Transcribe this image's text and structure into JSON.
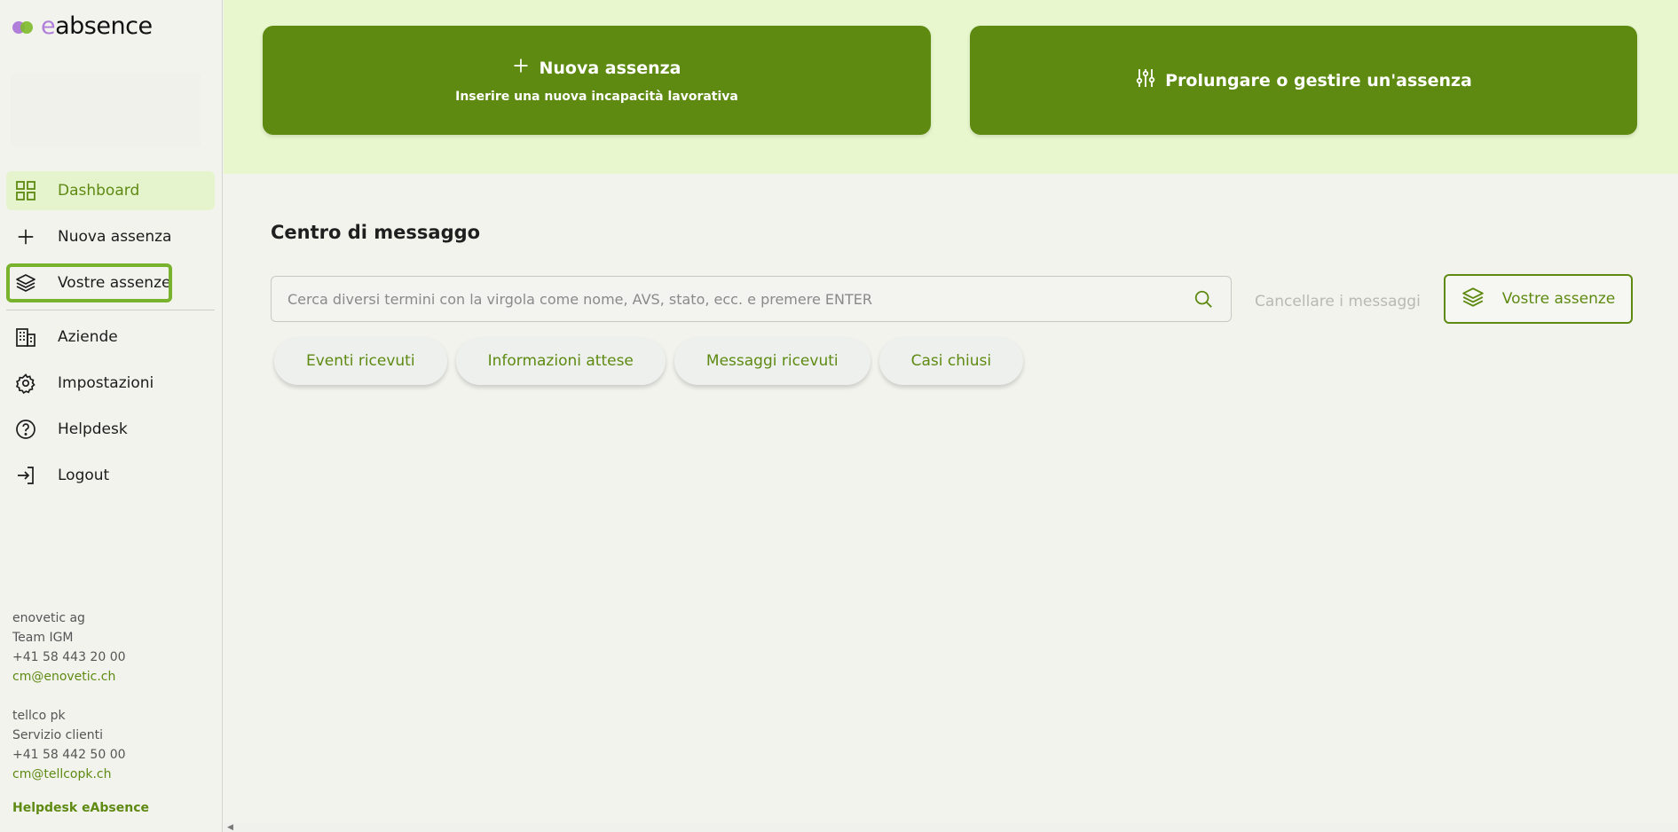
{
  "brand": {
    "logo_e": "e",
    "logo_rest": "absence",
    "accent": "#5e8a12",
    "logo_dot_colors": [
      "#b07fd9",
      "#7dbb2a"
    ]
  },
  "sidebar": {
    "items": [
      {
        "label": "Dashboard",
        "icon": "dashboard-grid-icon"
      },
      {
        "label": "Nuova assenza",
        "icon": "plus-icon"
      },
      {
        "label": "Vostre assenze",
        "icon": "layers-icon"
      },
      {
        "label": "Aziende",
        "icon": "building-icon"
      },
      {
        "label": "Impostazioni",
        "icon": "gear-icon"
      },
      {
        "label": "Helpdesk",
        "icon": "help-circle-icon"
      },
      {
        "label": "Logout",
        "icon": "logout-icon"
      }
    ],
    "contacts": {
      "company1": {
        "name": "enovetic ag",
        "team": "Team IGM",
        "phone": "+41 58 443 20 00",
        "email": "cm@enovetic.ch"
      },
      "company2": {
        "name": "tellco pk",
        "team": "Servizio clienti",
        "phone": "+41 58 442 50 00",
        "email": "cm@tellcopk.ch"
      },
      "helpdesk_link": "Helpdesk eAbsence"
    }
  },
  "banner": {
    "new_absence": {
      "title": "Nuova assenza",
      "subtitle": "Inserire una nuova incapacità lavorativa"
    },
    "manage_absence": {
      "title": "Prolungare o gestire un'assenza"
    }
  },
  "main": {
    "title": "Centro di messaggo",
    "search_placeholder": "Cerca diversi termini con la virgola come nome, AVS, stato, ecc. e premere ENTER",
    "clear_messages": "Cancellare i messaggi",
    "your_absences_button": "Vostre assenze",
    "chips": [
      "Eventi ricevuti",
      "Informazioni attese",
      "Messaggi ricevuti",
      "Casi chiusi"
    ]
  }
}
